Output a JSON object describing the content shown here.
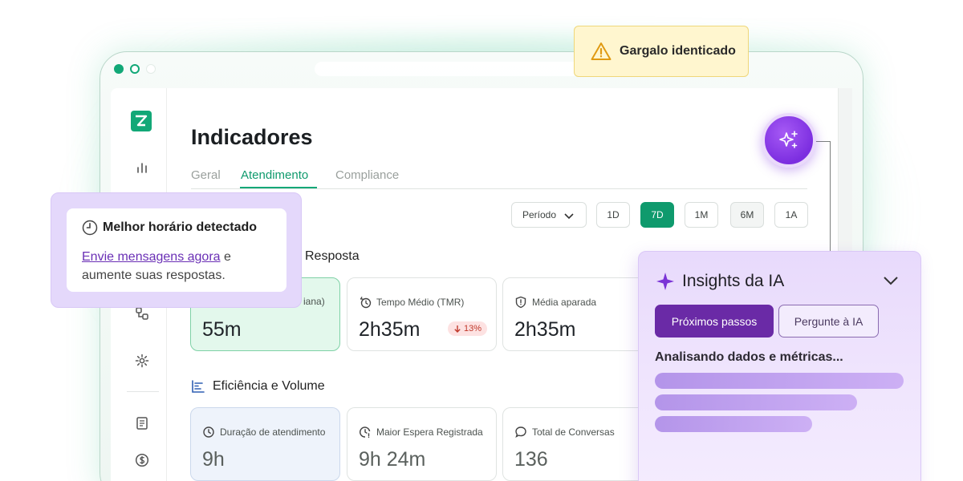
{
  "alert": {
    "text": "Gargalo identicado",
    "icon": "warning-icon"
  },
  "page": {
    "title": "Indicadores"
  },
  "tabs": [
    {
      "label": "Geral",
      "active": false
    },
    {
      "label": "Atendimento",
      "active": true
    },
    {
      "label": "Compliance",
      "active": false
    }
  ],
  "filters": {
    "period_label": "Período",
    "ranges": [
      "1D",
      "7D",
      "1M",
      "6M",
      "1A"
    ],
    "active_range": "7D"
  },
  "sections": {
    "response_title_partial": "Resposta",
    "efficiency_title": "Eficiência e Volume"
  },
  "response_cards": [
    {
      "label": "iana)",
      "value": "55m"
    },
    {
      "label": "Tempo Médio (TMR)",
      "value": "2h35m",
      "delta": "13%",
      "delta_direction": "down"
    },
    {
      "label": "Média aparada",
      "value": "2h35m"
    }
  ],
  "efficiency_cards": [
    {
      "label": "Duração de atendimento",
      "value": "9h"
    },
    {
      "label": "Maior Espera Registrada",
      "value": "9h 24m"
    },
    {
      "label": "Total de Conversas",
      "value": "136"
    }
  ],
  "tip": {
    "title": "Melhor horário detectado",
    "link_text": "Envie mensagens agora",
    "body_rest": " e aumente suas respostas."
  },
  "insights": {
    "title": "Insights da IA",
    "primary_button": "Próximos passos",
    "secondary_button": "Pergunte à IA",
    "status": "Analisando dados e métricas..."
  },
  "colors": {
    "brand_green": "#12a877",
    "ai_purple": "#7c2ee0",
    "alert_yellow": "#fff6cf"
  }
}
